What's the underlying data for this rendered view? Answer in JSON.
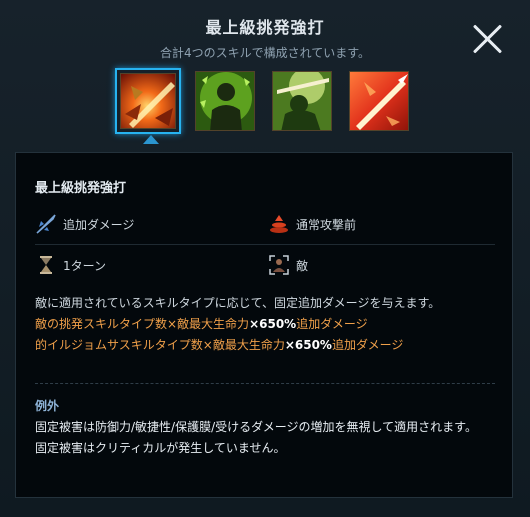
{
  "header": {
    "title": "最上級挑発強打",
    "subtitle": "合計4つのスキルで構成されています。"
  },
  "skills": [
    {
      "name": "flame-slash-skill-icon",
      "selected": true
    },
    {
      "name": "green-aura-figure-skill-icon",
      "selected": false
    },
    {
      "name": "green-warrior-skill-icon",
      "selected": false
    },
    {
      "name": "fire-spear-skill-icon",
      "selected": false
    }
  ],
  "panel": {
    "title": "最上級挑発強打",
    "attr1": "追加ダメージ",
    "attr2": "通常攻撃前",
    "attr3": "1ターン",
    "attr4": "敵",
    "desc_line1": "敵に適用されているスキルタイプに応じて、固定追加ダメージを与えます。",
    "desc_line2_a": "敵の挑発スキルタイプ数×敵最大生命力",
    "desc_line2_b": "×650%",
    "desc_line2_c": "追加ダメージ",
    "desc_line3_a": "的イルジョムサスキルタイプ数×敵最大生命力",
    "desc_line3_b": "×650%",
    "desc_line3_c": "追加ダメージ",
    "exception_title": "例外",
    "exception_line1": "固定被害は防御力/敏捷性/保護膜/受けるダメージの増加を無視して適用されます。",
    "exception_line2": "固定被害はクリティカルが発生していません。"
  },
  "colors": {
    "accent_blue": "#27b3f0",
    "orange_text": "#f0a04a",
    "exception_title": "#8fb4d8"
  }
}
